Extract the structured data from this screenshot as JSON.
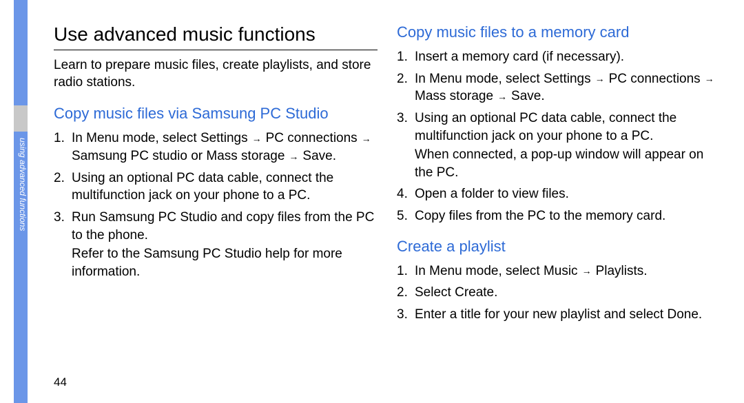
{
  "sidebar": {
    "label": "using advanced functions"
  },
  "page_number": "44",
  "left_column": {
    "main_heading": "Use advanced music functions",
    "intro": "Learn to prepare music files, create playlists, and store radio stations.",
    "section1": {
      "heading": "Copy music files via Samsung PC Studio",
      "items": [
        {
          "pre": "In Menu mode, select ",
          "path1": "Settings",
          "path2": "PC connections",
          "path3": "Samsung PC studio",
          "or": " or ",
          "path4": "Mass storage",
          "path5": "Save",
          "post": "."
        },
        {
          "text": "Using an optional PC data cable, connect the multifunction jack on your phone to a PC."
        },
        {
          "text": "Run Samsung PC Studio and copy files from the PC to the phone.",
          "continue": "Refer to the Samsung PC Studio help for more information."
        }
      ]
    }
  },
  "right_column": {
    "section1": {
      "heading": "Copy music files to a memory card",
      "items": [
        {
          "text": "Insert a memory card (if necessary)."
        },
        {
          "pre": "In Menu mode, select ",
          "path1": "Settings",
          "path2": "PC connections",
          "path3": "Mass storage",
          "path4": "Save",
          "post": "."
        },
        {
          "text": "Using an optional PC data cable, connect the multifunction jack on your phone to a PC.",
          "continue": "When connected, a pop-up window will appear on the PC."
        },
        {
          "text": "Open a folder to view files."
        },
        {
          "text": "Copy files from the PC to the memory card."
        }
      ]
    },
    "section2": {
      "heading": "Create a playlist",
      "items": [
        {
          "pre": "In Menu mode, select ",
          "path1": "Music",
          "path2": "Playlists",
          "post": "."
        },
        {
          "pre": "Select ",
          "path1": "Create",
          "post": "."
        },
        {
          "pre": "Enter a title for your new playlist and select ",
          "path1": "Done",
          "post": "."
        }
      ]
    }
  },
  "arrow": "→"
}
